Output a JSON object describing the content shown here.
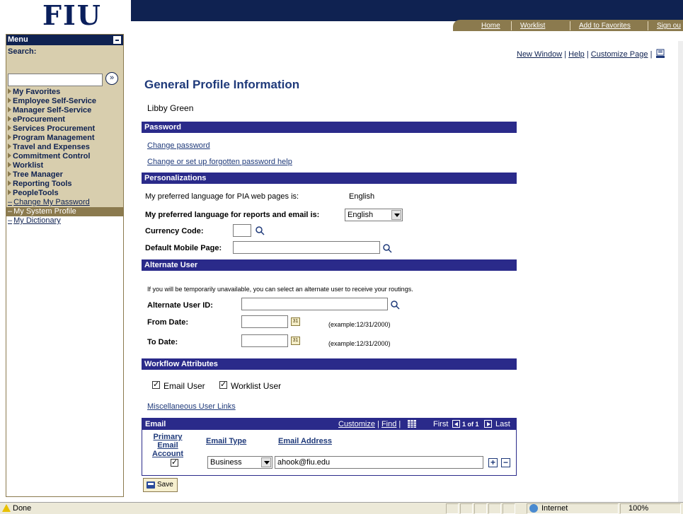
{
  "header": {
    "logo": "FIU",
    "nav": [
      "Home",
      "Worklist",
      "Add to Favorites",
      "Sign ou"
    ]
  },
  "menu": {
    "title": "Menu",
    "search_label": "Search:",
    "search_value": "",
    "go_glyph": "»",
    "folders": [
      "My Favorites",
      "Employee Self-Service",
      "Manager Self-Service",
      "eProcurement",
      "Services Procurement",
      "Program Management",
      "Travel and Expenses",
      "Commitment Control",
      "Worklist",
      "Tree Manager",
      "Reporting Tools",
      "PeopleTools"
    ],
    "links": [
      {
        "label": "Change My Password",
        "selected": false
      },
      {
        "label": "My System Profile",
        "selected": true
      },
      {
        "label": "My Dictionary",
        "selected": false
      }
    ]
  },
  "top_links": {
    "new_window": "New Window",
    "help": "Help",
    "customize": "Customize Page",
    "sep": "|"
  },
  "page": {
    "title": "General Profile Information",
    "user_name": "Libby Green"
  },
  "password": {
    "section": "Password",
    "change": "Change password",
    "forgot": "Change or set up forgotten password help"
  },
  "personalizations": {
    "section": "Personalizations",
    "pia_label": "My preferred language for PIA web pages is:",
    "pia_value": "English",
    "report_label": "My preferred language for reports and email is:",
    "report_value": "English",
    "currency_label": "Currency Code:",
    "currency_value": "",
    "mobile_label": "Default Mobile Page:",
    "mobile_value": ""
  },
  "alternate_user": {
    "section": "Alternate User",
    "note": "If you will be temporarily unavailable, you can select an alternate user to receive your routings.",
    "id_label": "Alternate User ID:",
    "id_value": "",
    "from_label": "From Date:",
    "from_value": "",
    "to_label": "To Date:",
    "to_value": "",
    "example": "(example:12/31/2000)",
    "cal_glyph": "31"
  },
  "workflow": {
    "section": "Workflow Attributes",
    "email_user": "Email User",
    "email_user_checked": true,
    "worklist_user": "Worklist User",
    "worklist_user_checked": true,
    "misc_link": "Miscellaneous User Links"
  },
  "email_grid": {
    "title": "Email",
    "customize": "Customize",
    "find": "Find",
    "sep": "|",
    "first": "First",
    "range": "1 of 1",
    "last": "Last",
    "col_primary": "Primary Email Account",
    "col_type": "Email Type",
    "col_address": "Email Address",
    "rows": [
      {
        "primary": true,
        "type": "Business",
        "address": "ahook@fiu.edu"
      }
    ],
    "add_glyph": "+",
    "remove_glyph": "−"
  },
  "save_label": "Save",
  "statusbar": {
    "status": "Done",
    "zone": "Internet",
    "zoom": "100%"
  }
}
